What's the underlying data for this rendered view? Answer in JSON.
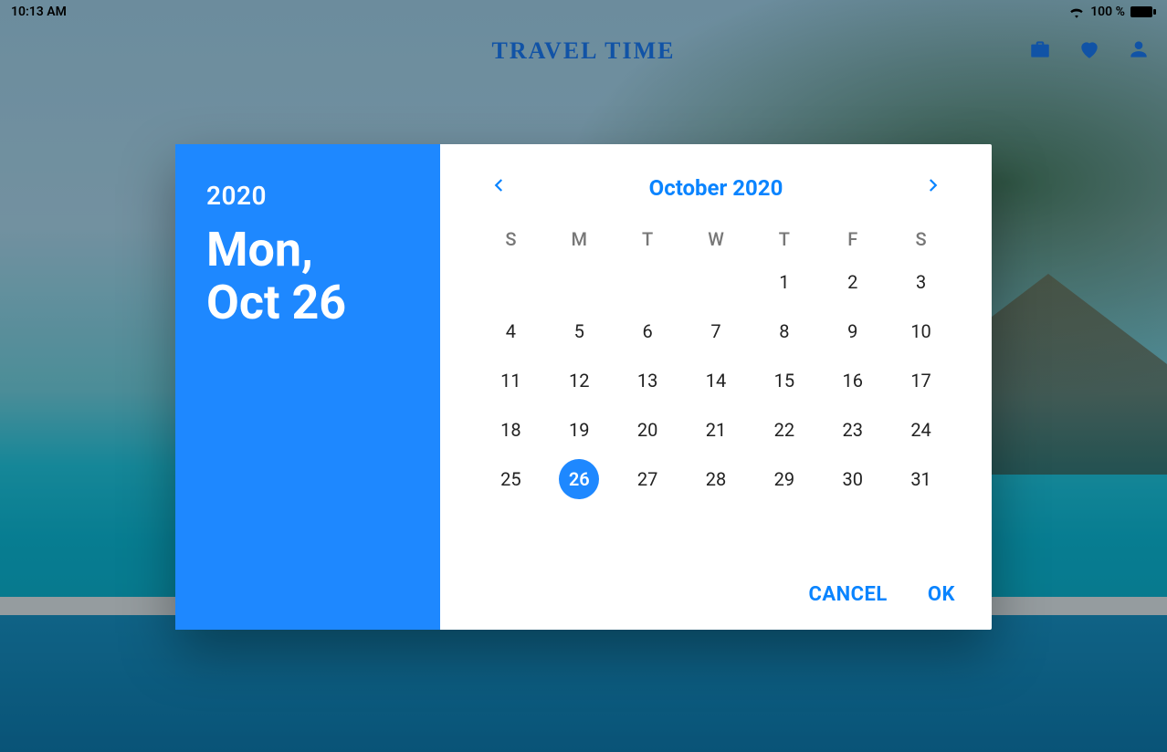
{
  "statusbar": {
    "time": "10:13 AM",
    "battery_text": "100 %",
    "wifi_icon": "wifi",
    "battery_icon": "battery-full"
  },
  "header": {
    "logo_text": "TRAVEL TIME",
    "actions": {
      "briefcase": "briefcase-icon",
      "heart": "heart-icon",
      "person": "person-icon"
    }
  },
  "datepicker": {
    "accent_color": "#1e88ff",
    "year_label": "2020",
    "selected_display_line1": "Mon,",
    "selected_display_line2": "Oct 26",
    "month_title": "October 2020",
    "weekday_labels": [
      "S",
      "M",
      "T",
      "W",
      "T",
      "F",
      "S"
    ],
    "weeks": [
      [
        "",
        "",
        "",
        "",
        "1",
        "2",
        "3"
      ],
      [
        "4",
        "5",
        "6",
        "7",
        "8",
        "9",
        "10"
      ],
      [
        "11",
        "12",
        "13",
        "14",
        "15",
        "16",
        "17"
      ],
      [
        "18",
        "19",
        "20",
        "21",
        "22",
        "23",
        "24"
      ],
      [
        "25",
        "26",
        "27",
        "28",
        "29",
        "30",
        "31"
      ]
    ],
    "selected_day": "26",
    "buttons": {
      "cancel": "CANCEL",
      "ok": "OK"
    }
  }
}
